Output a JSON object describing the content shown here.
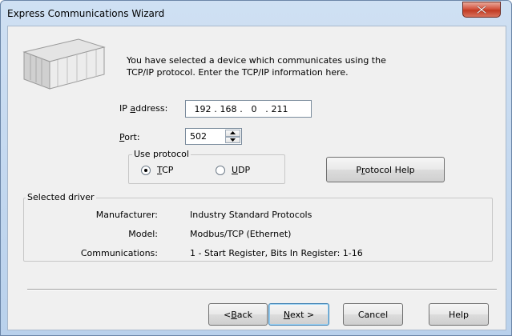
{
  "window": {
    "title": "Express Communications Wizard"
  },
  "intro": {
    "line1": "You have selected a device which communicates using the",
    "line2": "TCP/IP protocol. Enter the TCP/IP information here."
  },
  "ip": {
    "label_pre": "IP ",
    "label_mn": "a",
    "label_post": "ddress:",
    "octets": [
      "192",
      "168",
      "0",
      "211"
    ]
  },
  "port": {
    "label_mn": "P",
    "label_post": "ort:",
    "value": "502"
  },
  "protocol": {
    "group_label": "Use protocol",
    "tcp_mn": "T",
    "tcp_rest": "CP",
    "udp_mn": "U",
    "udp_rest": "DP",
    "selected": "TCP",
    "help_pre": "P",
    "help_mn": "r",
    "help_post": "otocol Help"
  },
  "driver": {
    "group_label": "Selected driver",
    "fields": [
      {
        "key": "Manufacturer:",
        "value": "Industry Standard Protocols"
      },
      {
        "key": "Model:",
        "value": "Modbus/TCP (Ethernet)"
      },
      {
        "key": "Communications:",
        "value": "1 - Start Register, Bits In Register: 1-16"
      }
    ]
  },
  "buttons": {
    "back_pre": "< ",
    "back_mn": "B",
    "back_post": "ack",
    "next_mn": "N",
    "next_post": "ext >",
    "cancel": "Cancel",
    "help": "Help"
  },
  "icons": {
    "close": "close-icon",
    "device": "device-chassis-icon",
    "spin_up": "spin-up-icon",
    "spin_down": "spin-down-icon"
  },
  "colors": {
    "close_button": "#c9452b",
    "title_bar": "#c4d9f1",
    "dialog_bg": "#f0f0f0"
  }
}
